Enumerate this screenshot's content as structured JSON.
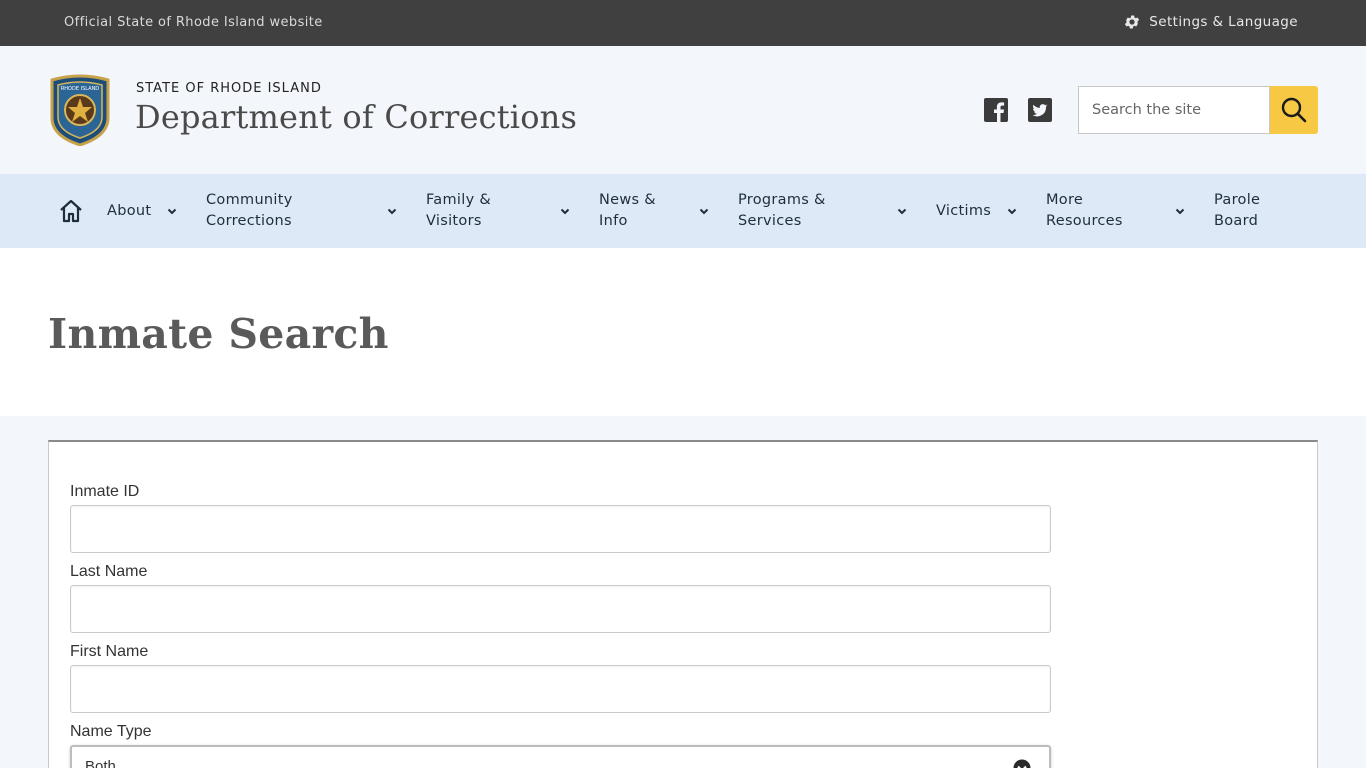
{
  "topbar": {
    "official_text": "Official State of Rhode Island website",
    "settings_label": "Settings & Language",
    "settings_icon": "gear-icon"
  },
  "header": {
    "state_name": "STATE OF RHODE ISLAND",
    "department_name": "Department of Corrections",
    "seal_icon": "state-seal-logo",
    "seal_text": "RHODE ISLAND DEPARTMENT OF CORRECTIONS",
    "social": [
      "facebook-icon",
      "twitter-icon"
    ],
    "search": {
      "placeholder": "Search the site",
      "value": ""
    },
    "accent_color": "#f6c843"
  },
  "nav": {
    "home_icon": "home-icon",
    "items": [
      {
        "label": "About",
        "has_dropdown": true
      },
      {
        "label": "Community\nCorrections",
        "has_dropdown": true
      },
      {
        "label": "Family &\nVisitors",
        "has_dropdown": true
      },
      {
        "label": "News &\nInfo",
        "has_dropdown": true
      },
      {
        "label": "Programs &\nServices",
        "has_dropdown": true
      },
      {
        "label": "Victims",
        "has_dropdown": true
      },
      {
        "label": "More\nResources",
        "has_dropdown": true
      },
      {
        "label": "Parole\nBoard",
        "has_dropdown": false
      }
    ]
  },
  "page": {
    "title": "Inmate Search"
  },
  "form": {
    "fields": [
      {
        "label": "Inmate ID",
        "value": ""
      },
      {
        "label": "Last Name",
        "value": ""
      },
      {
        "label": "First Name",
        "value": ""
      }
    ],
    "name_type": {
      "label": "Name Type",
      "selected": "Both"
    }
  }
}
